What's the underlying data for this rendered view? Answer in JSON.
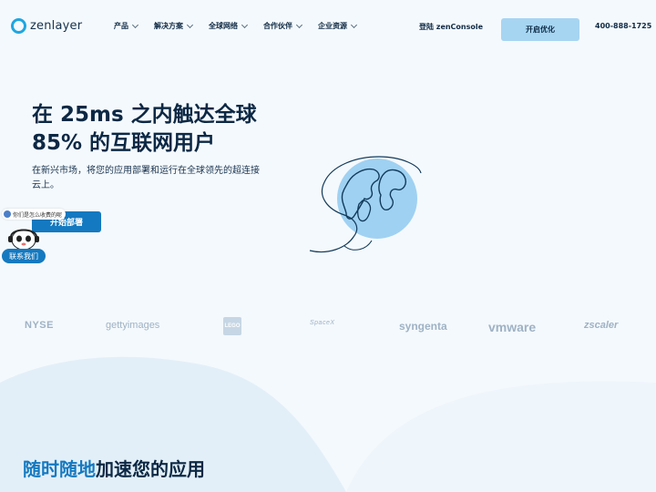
{
  "header": {
    "logo_text": "zenlayer",
    "nav": [
      {
        "label": "产品"
      },
      {
        "label": "解决方案"
      },
      {
        "label": "全球网络"
      },
      {
        "label": "合作伙伴"
      },
      {
        "label": "企业资源"
      }
    ],
    "login_label": "登陆 zenConsole",
    "cta_label": "开启优化",
    "phone": "400-888-1725"
  },
  "hero": {
    "title_line1": "在 25ms 之内触达全球",
    "title_line2": "85% 的互联网用户",
    "subtitle": "在新兴市场，将您的应用部署和运行在全球领先的超连接云上。",
    "button_label": "开始部署"
  },
  "chat": {
    "bubble_text": "你们是怎么收费的呢",
    "contact_label": "联系我们"
  },
  "brands": [
    "NYSE",
    "gettyimages",
    "LEGO",
    "SpaceX",
    "syngenta",
    "vmware",
    "zscaler"
  ],
  "bottom": {
    "title_accent": "随时随地",
    "title_rest": "加速您的应用"
  },
  "colors": {
    "accent": "#1479c0",
    "cta_light": "#a6d5f2",
    "globe": "#9fd1f2",
    "logo_ring": "#1fa6e0"
  }
}
